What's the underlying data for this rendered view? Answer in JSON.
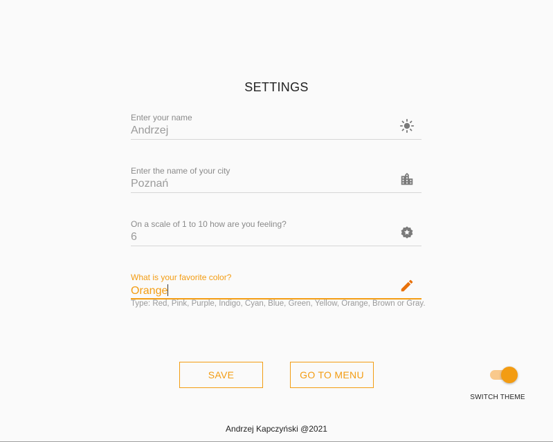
{
  "page": {
    "title": "SETTINGS"
  },
  "fields": [
    {
      "label": "Enter your name",
      "value": "Andrzej",
      "icon": "brightness-icon"
    },
    {
      "label": "Enter the name of your city",
      "value": "Poznań",
      "icon": "city-icon"
    },
    {
      "label": "On a scale of 1 to 10 how are you feeling?",
      "value": "6",
      "icon": "star-badge-icon"
    },
    {
      "label": "What is your favorite color?",
      "value": "Orange",
      "icon": "pencil-icon",
      "helper": "Type: Red, Pink, Purple, Indigo, Cyan, Blue, Green, Yellow, Orange, Brown or Gray.",
      "focused": true
    }
  ],
  "buttons": {
    "save_label": "SAVE",
    "menu_label": "GO TO MENU"
  },
  "theme_switch": {
    "label": "SWITCH THEME",
    "checked": true
  },
  "footer": {
    "text": "Andrzej Kapczyński @2021"
  },
  "colors": {
    "accent": "#f39c12",
    "background": "#fafafa",
    "muted_text": "#9a9a9a"
  }
}
